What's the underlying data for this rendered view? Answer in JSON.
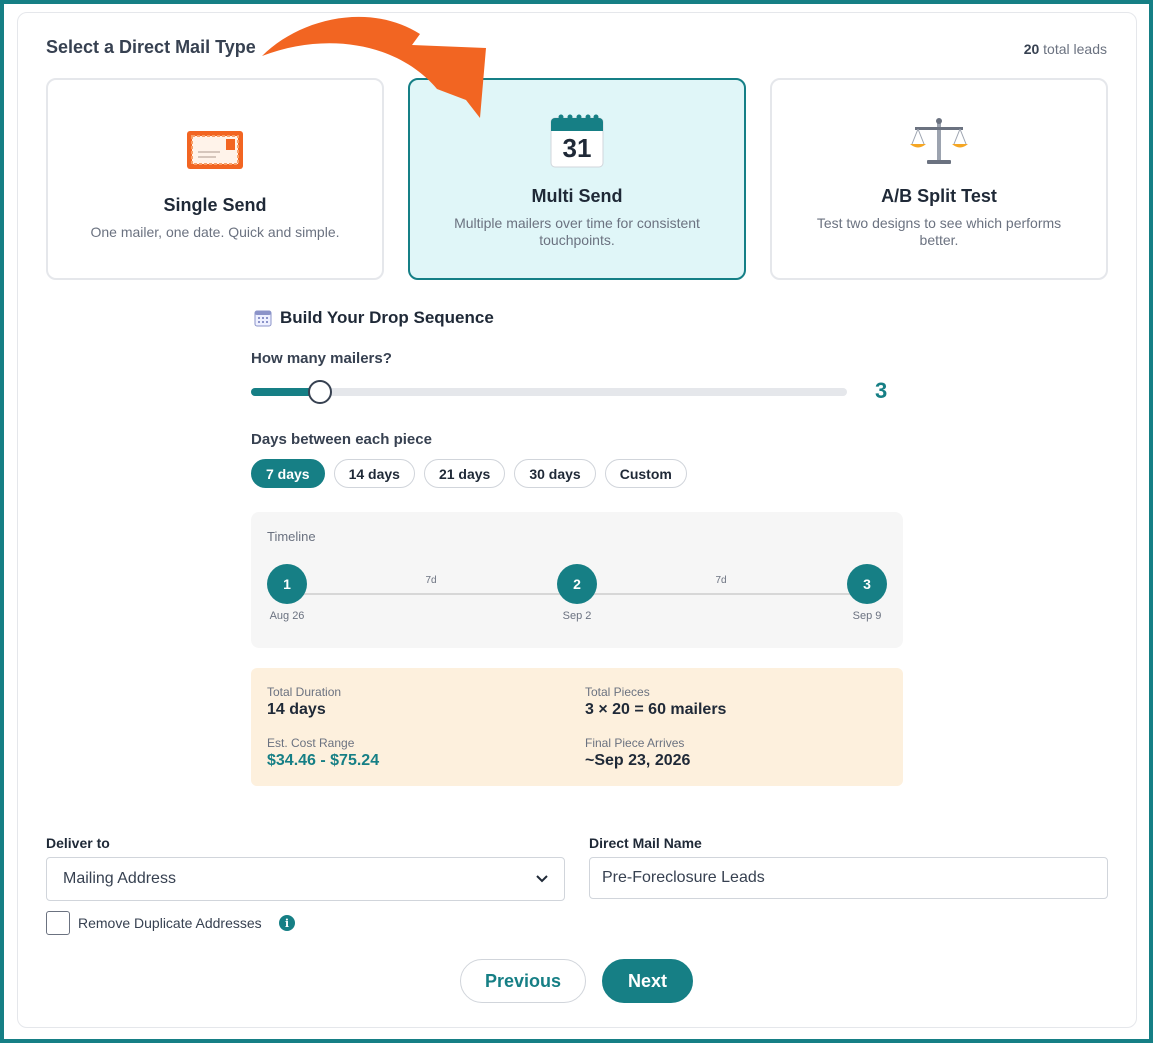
{
  "header": {
    "title": "Select a Direct Mail Type",
    "leads_count": "20",
    "leads_suffix": "total leads"
  },
  "mail_types": [
    {
      "title": "Single Send",
      "description": "One mailer, one date. Quick and simple.",
      "icon": "envelope-icon",
      "selected": false
    },
    {
      "title": "Multi Send",
      "description": "Multiple mailers over time for consistent touchpoints.",
      "icon": "calendar-icon",
      "calendar_day": "31",
      "selected": true
    },
    {
      "title": "A/B Split Test",
      "description": "Test two designs to see which performs better.",
      "icon": "scales-icon",
      "selected": false
    }
  ],
  "sequence": {
    "title": "Build Your Drop Sequence",
    "mailers_label": "How many mailers?",
    "mailers_value": "3",
    "mailers_fraction": 0.115,
    "days_label": "Days between each piece",
    "day_options": [
      "7 days",
      "14 days",
      "21 days",
      "30 days",
      "Custom"
    ],
    "selected_day_option": "7 days"
  },
  "timeline": {
    "title": "Timeline",
    "nodes": [
      {
        "number": "1",
        "date": "Aug 26"
      },
      {
        "number": "2",
        "date": "Sep 2"
      },
      {
        "number": "3",
        "date": "Sep 9"
      }
    ],
    "gaps": [
      "7d",
      "7d"
    ]
  },
  "summary": {
    "total_duration_label": "Total Duration",
    "total_duration_value": "14 days",
    "total_pieces_label": "Total Pieces",
    "total_pieces_value": "3 × 20 = 60 mailers",
    "cost_label": "Est. Cost Range",
    "cost_value": "$34.46 - $75.24",
    "final_label": "Final Piece Arrives",
    "final_value": "~Sep 23, 2026"
  },
  "form": {
    "deliver_label": "Deliver to",
    "deliver_value": "Mailing Address",
    "name_label": "Direct Mail Name",
    "name_value": "Pre-Foreclosure Leads",
    "dedupe_label": "Remove Duplicate Addresses",
    "info_glyph": "i"
  },
  "actions": {
    "previous": "Previous",
    "next": "Next"
  },
  "colors": {
    "accent": "#167f85",
    "selected_bg": "#e0f6f8",
    "summary_bg": "#fdf0dd",
    "arrow": "#f26522"
  }
}
